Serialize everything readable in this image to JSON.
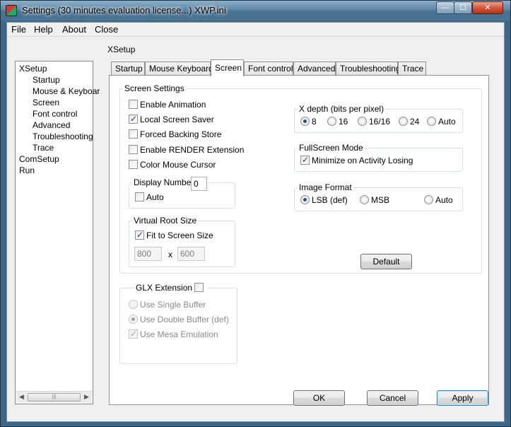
{
  "window": {
    "title": "Settings (30 minutes evaluation license...) XWP.ini",
    "minimize_glyph": "—",
    "maximize_glyph": "☐",
    "close_glyph": "✕"
  },
  "menu": [
    "File",
    "Help",
    "About",
    "Close"
  ],
  "tree": {
    "items": [
      {
        "label": "XSetup",
        "level": 1
      },
      {
        "label": "Startup",
        "level": 2
      },
      {
        "label": "Mouse & Keyboar",
        "level": 2
      },
      {
        "label": "Screen",
        "level": 2
      },
      {
        "label": "Font control",
        "level": 2
      },
      {
        "label": "Advanced",
        "level": 2
      },
      {
        "label": "Troubleshooting",
        "level": 2
      },
      {
        "label": "Trace",
        "level": 2
      },
      {
        "label": "ComSetup",
        "level": 1
      },
      {
        "label": "Run",
        "level": 1
      }
    ],
    "scroll_left_glyph": "◀",
    "scroll_right_glyph": "▶",
    "scroll_thumb_grip": "|||"
  },
  "section_title": "XSetup",
  "tabs": [
    "Startup",
    "Mouse  Keyboard",
    "Screen",
    "Font control",
    "Advanced",
    "Troubleshooting",
    "Trace"
  ],
  "active_tab": "Screen",
  "screen_settings": {
    "title": "Screen Settings",
    "options": [
      {
        "label": "Enable Animation",
        "checked": false
      },
      {
        "label": "Local Screen Saver",
        "checked": true
      },
      {
        "label": "Forced Backing Store",
        "checked": false
      },
      {
        "label": "Enable RENDER Extension",
        "checked": false
      },
      {
        "label": "Color Mouse Cursor",
        "checked": false
      }
    ],
    "display_number": {
      "label": "Display Number:",
      "value": "0",
      "auto_label": "Auto",
      "auto_checked": false
    },
    "virtual_root": {
      "title": "Virtual Root Size",
      "fit_label": "Fit to Screen Size",
      "fit_checked": true,
      "width": "800",
      "separator": "x",
      "height": "600"
    },
    "x_depth": {
      "title": "X depth (bits per pixel)",
      "options": [
        "8",
        "16",
        "16/16",
        "24",
        "Auto"
      ],
      "selected": "8"
    },
    "fullscreen": {
      "title": "FullScreen Mode",
      "minimize_label": "Minimize on Activity Losing",
      "minimize_checked": true
    },
    "image_format": {
      "title": "Image Format",
      "options": [
        "LSB (def)",
        "MSB",
        "Auto"
      ],
      "selected": "LSB (def)"
    },
    "default_button": "Default"
  },
  "glx": {
    "title": "GLX Extension",
    "enabled": false,
    "single_buffer": "Use Single Buffer",
    "double_buffer": "Use Double Buffer (def)",
    "mesa": "Use Mesa Emulation",
    "double_selected": true,
    "mesa_checked": true
  },
  "buttons": {
    "ok": "OK",
    "cancel": "Cancel",
    "apply": "Apply"
  }
}
